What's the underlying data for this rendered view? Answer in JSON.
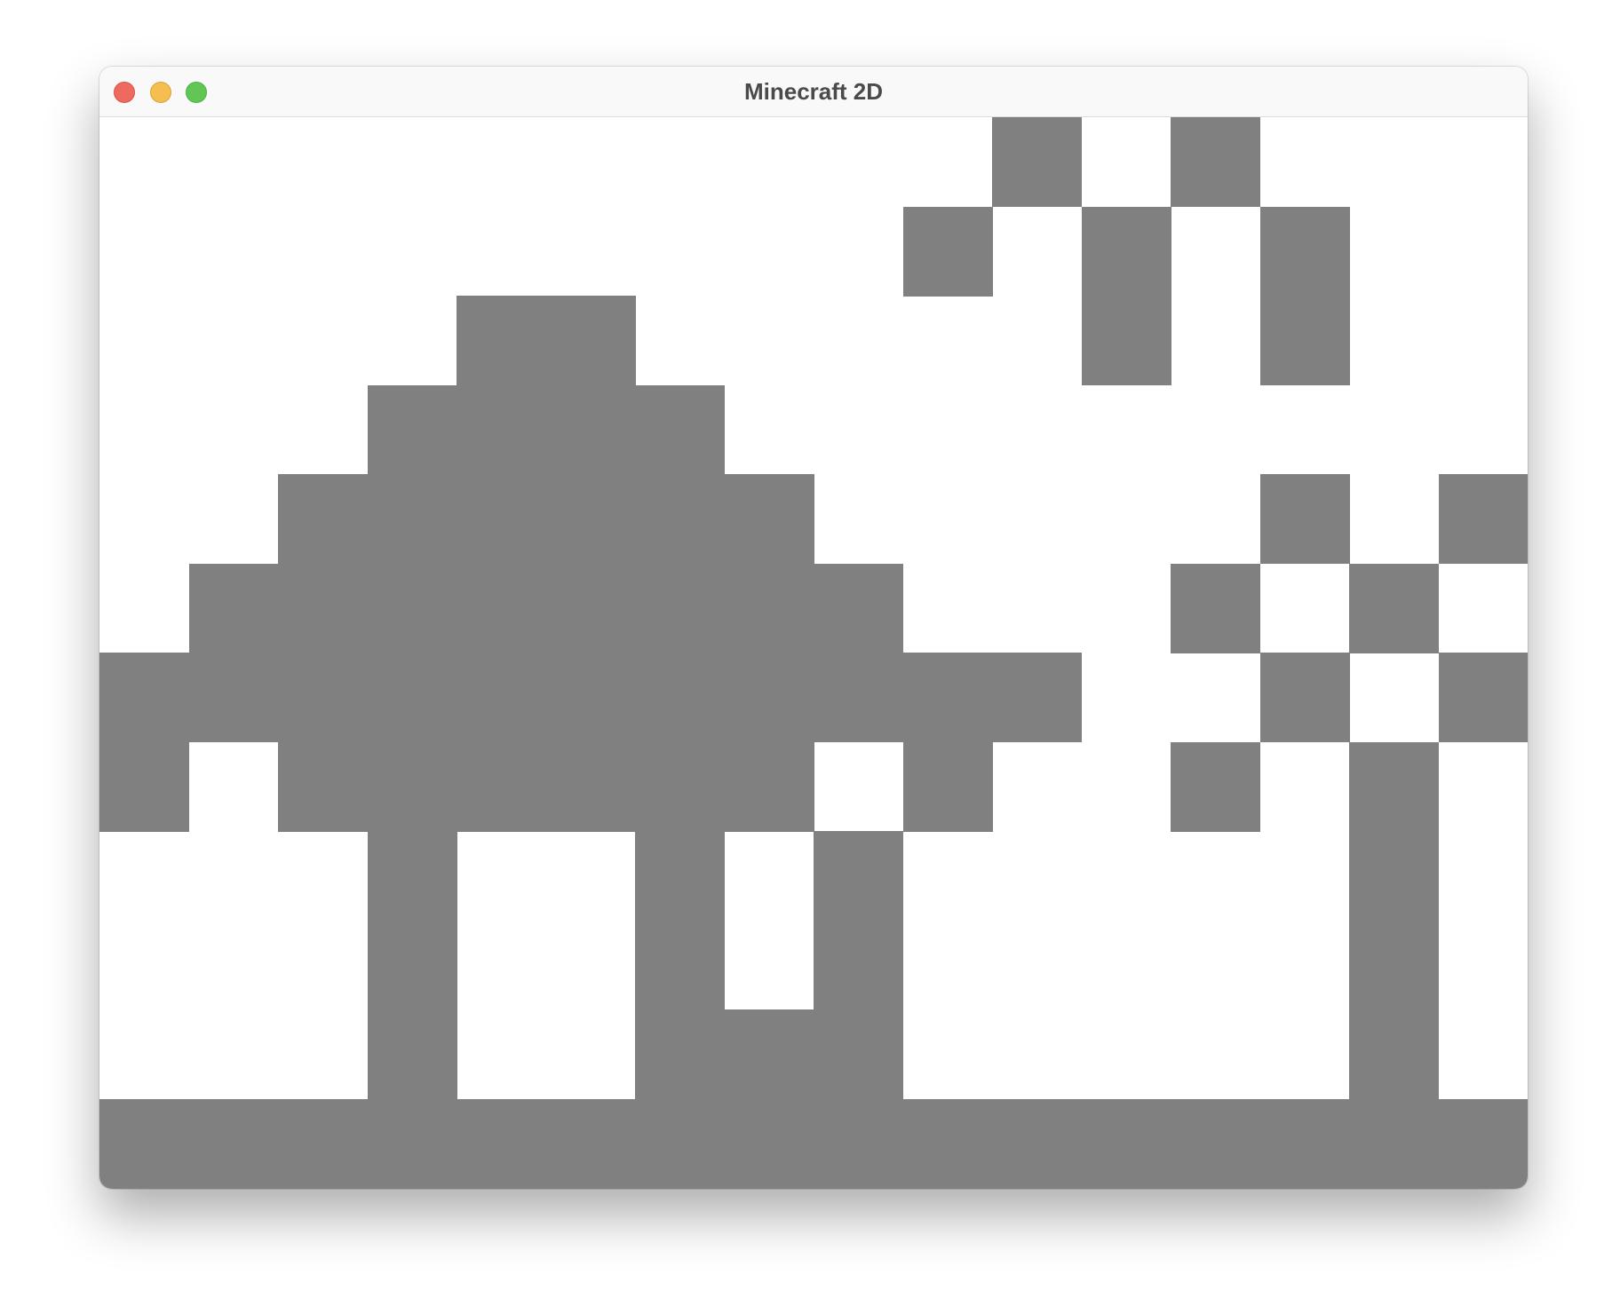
{
  "window": {
    "title": "Minecraft 2D"
  },
  "world": {
    "columns": 16,
    "rows": 12,
    "colors": {
      "sky": "#ffffff",
      "block": "#808080"
    },
    "grid": [
      "..........#.#...",
      ".........#.#.#..",
      "....##.....#.#..",
      "...####.........",
      "..######.....#.#.",
      ".########...#.#.#",
      "###########..#.#.",
      "#.######.#..#.#.#",
      "...#..#.#.....#..",
      "...#..#.#.....#..",
      "...#..###.....#..",
      "################"
    ]
  }
}
